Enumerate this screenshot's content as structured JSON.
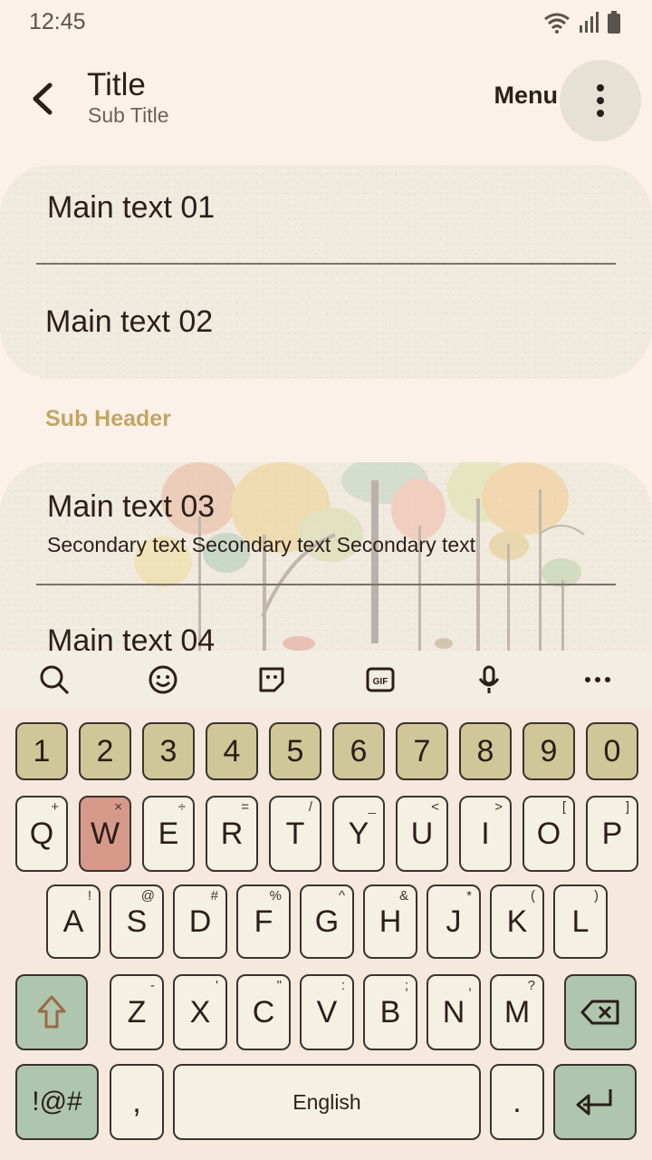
{
  "status_bar": {
    "time": "12:45"
  },
  "app_bar": {
    "title": "Title",
    "subtitle": "Sub Title",
    "menu_label": "Menu"
  },
  "list": {
    "item1": "Main text 01",
    "item2": "Main text 02",
    "subheader": "Sub Header",
    "item3": "Main text 03",
    "item3_secondary": "Secondary text Secondary text Secondary text",
    "item4": "Main text 04"
  },
  "keyboard": {
    "toolbar_icons": [
      "search-icon",
      "emoji-icon",
      "sticker-icon",
      "gif-icon",
      "mic-icon",
      "more-icon"
    ],
    "gif_label": "GIF",
    "numbers": [
      "1",
      "2",
      "3",
      "4",
      "5",
      "6",
      "7",
      "8",
      "9",
      "0"
    ],
    "row1": [
      {
        "key": "Q",
        "sym": "+"
      },
      {
        "key": "W",
        "sym": "×"
      },
      {
        "key": "E",
        "sym": "÷"
      },
      {
        "key": "R",
        "sym": "="
      },
      {
        "key": "T",
        "sym": "/"
      },
      {
        "key": "Y",
        "sym": "_"
      },
      {
        "key": "U",
        "sym": "<"
      },
      {
        "key": "I",
        "sym": ">"
      },
      {
        "key": "O",
        "sym": "["
      },
      {
        "key": "P",
        "sym": "]"
      }
    ],
    "row2": [
      {
        "key": "A",
        "sym": "!"
      },
      {
        "key": "S",
        "sym": "@"
      },
      {
        "key": "D",
        "sym": "#"
      },
      {
        "key": "F",
        "sym": "%"
      },
      {
        "key": "G",
        "sym": "^"
      },
      {
        "key": "H",
        "sym": "&"
      },
      {
        "key": "J",
        "sym": "*"
      },
      {
        "key": "K",
        "sym": "("
      },
      {
        "key": "L",
        "sym": ")"
      }
    ],
    "row3": [
      {
        "key": "Z",
        "sym": "-"
      },
      {
        "key": "X",
        "sym": "'"
      },
      {
        "key": "C",
        "sym": "\""
      },
      {
        "key": "V",
        "sym": ":"
      },
      {
        "key": "B",
        "sym": ";"
      },
      {
        "key": "N",
        "sym": ","
      },
      {
        "key": "M",
        "sym": "?"
      }
    ],
    "symbols_key": "!@#",
    "comma_key": ",",
    "space_label": "English",
    "period_key": ".",
    "highlight_key": "W",
    "colors": {
      "number_key": "#cfc797",
      "highlight_key": "#d7998a",
      "function_key": "#aec6ad",
      "letter_key": "#f4f0e2"
    }
  }
}
